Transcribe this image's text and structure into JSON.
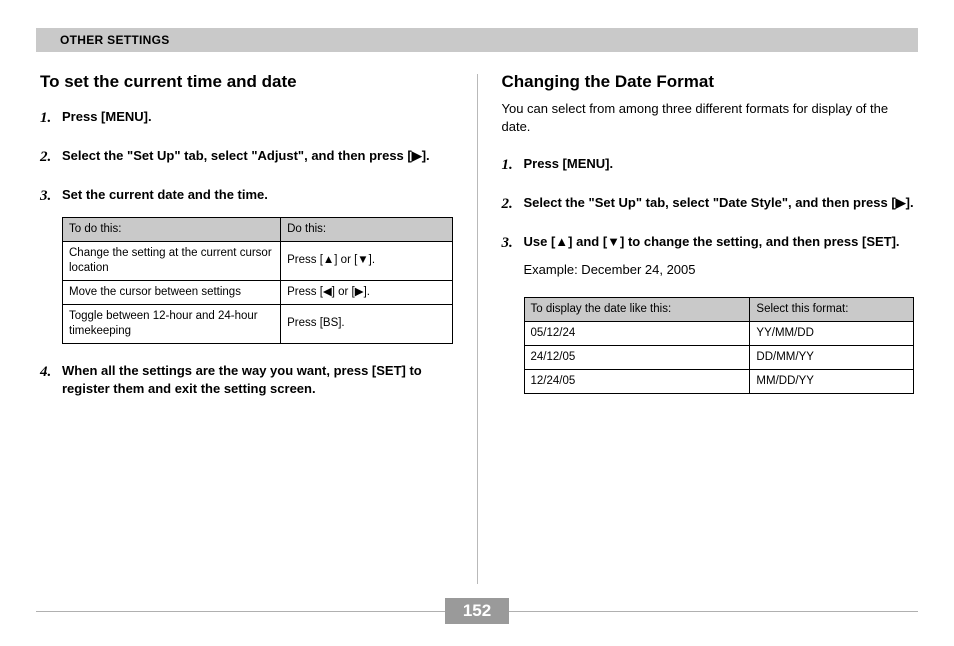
{
  "header": "OTHER SETTINGS",
  "page_number": "152",
  "triangles": {
    "right": "▶",
    "up": "▲",
    "down": "▼",
    "left": "◀"
  },
  "left": {
    "title": "To set the current time and date",
    "steps": [
      {
        "n": "1.",
        "t": "Press [MENU]."
      },
      {
        "n": "2.",
        "t": "Select the \"Set Up\" tab, select \"Adjust\", and then press [▶]."
      },
      {
        "n": "3.",
        "t": "Set the current date and the time."
      },
      {
        "n": "4.",
        "t": "When all the settings are the way you want, press [SET] to register them and exit the setting screen."
      }
    ],
    "table": {
      "head": [
        "To do this:",
        "Do this:"
      ],
      "rows": [
        [
          "Change the setting at the current cursor location",
          "Press [▲] or [▼]."
        ],
        [
          "Move the cursor between settings",
          "Press [◀] or [▶]."
        ],
        [
          "Toggle between 12-hour and 24-hour timekeeping",
          "Press [BS]."
        ]
      ]
    }
  },
  "right": {
    "title": "Changing the Date Format",
    "intro": "You can select from among three different formats for display of the date.",
    "steps": [
      {
        "n": "1.",
        "t": "Press [MENU]."
      },
      {
        "n": "2.",
        "t": "Select the \"Set Up\" tab, select \"Date Style\", and then press [▶]."
      },
      {
        "n": "3.",
        "t": "Use [▲] and [▼] to change the setting, and then press [SET]."
      }
    ],
    "example": "Example: December 24, 2005",
    "table": {
      "head": [
        "To display the date like this:",
        "Select this format:"
      ],
      "rows": [
        [
          "05/12/24",
          "YY/MM/DD"
        ],
        [
          "24/12/05",
          "DD/MM/YY"
        ],
        [
          "12/24/05",
          "MM/DD/YY"
        ]
      ]
    }
  }
}
